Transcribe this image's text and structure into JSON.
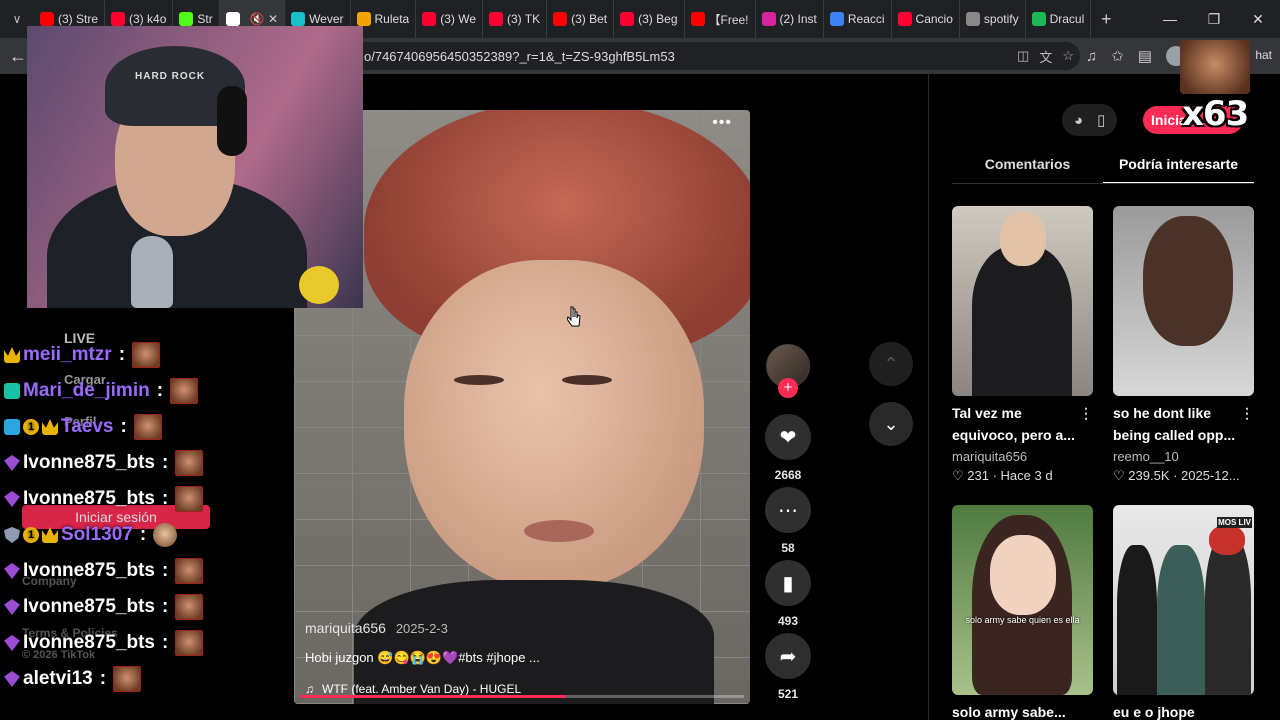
{
  "browser": {
    "tabs": [
      {
        "label": "(3) Stre",
        "color": "#ff0000"
      },
      {
        "label": "(3) k4o",
        "color": "#ff0033"
      },
      {
        "label": "Str",
        "color": "#53fc18"
      },
      {
        "label": "",
        "color": "#ffffff"
      },
      {
        "label": "Wever",
        "color": "#18c0c8"
      },
      {
        "label": "Ruleta",
        "color": "#f2a500"
      },
      {
        "label": "(3) We",
        "color": "#ff0033"
      },
      {
        "label": "(3) TK",
        "color": "#ff0033"
      },
      {
        "label": "(3) Bet",
        "color": "#ff0000"
      },
      {
        "label": "(3) Beg",
        "color": "#ff0033"
      },
      {
        "label": "【Free!",
        "color": "#ff0000"
      },
      {
        "label": "(2) Inst",
        "color": "#d6249f"
      },
      {
        "label": "Reacci",
        "color": "#3b82f6"
      },
      {
        "label": "Cancio",
        "color": "#ff0033"
      },
      {
        "label": "spotify",
        "color": "#888888"
      },
      {
        "label": "Dracul",
        "color": "#1db954"
      }
    ],
    "url": "o/7467406956450352389?_r=1&_t=ZS-93ghfB5Lm53",
    "chat_label": "hat"
  },
  "video": {
    "author": "mariquita656",
    "date": "2025-2-3",
    "caption": "Hobi juzgon 😅😋😭😍💜#bts #jhope ...",
    "music": "WTF (feat. Amber Van Day) - HUGEL",
    "progress": 0.6,
    "more_label": "•••"
  },
  "actions": {
    "likes": "2668",
    "comments": "58",
    "saves": "493",
    "shares": "521"
  },
  "right_panel": {
    "login": "Inicia",
    "tabs": [
      "Comentarios",
      "Podría interesarte"
    ],
    "cards": [
      {
        "title": "Tal vez me equivoco, pero a...",
        "author": "mariquita656",
        "likes": "231",
        "age": "Hace 3 d"
      },
      {
        "title": "so he dont like being called opp...",
        "author": "reemo__10",
        "likes": "239.5K",
        "age": "2025-12..."
      },
      {
        "title": "solo army sabe...",
        "author": "",
        "likes": "",
        "age": "",
        "overlay": "solo army sabe quien es ella"
      },
      {
        "title": "eu e o jhope tendo...",
        "author": "",
        "likes": "",
        "age": "",
        "overlay": "MOS LIV"
      }
    ]
  },
  "streamer": {
    "cap_text": "Hard Rock MONTRÉAL",
    "x_count": "x63"
  },
  "sidebar_remnants": {
    "live": "LIVE",
    "upload": "Cargar",
    "profile": "Perfil",
    "login": "Iniciar sesión",
    "company": "Company",
    "terms": "Terms & Policies",
    "copyright": "© 2026 TikTok"
  },
  "chat": [
    {
      "user": "meii_mtzr",
      "color": "#9b6bff",
      "badges": [
        "crown"
      ]
    },
    {
      "user": "Mari_de_jimin",
      "color": "#9b6bff",
      "badges": [
        "vip"
      ]
    },
    {
      "user": "Taevs",
      "color": "#9b6bff",
      "badges": [
        "cube",
        "one",
        "crown"
      ]
    },
    {
      "user": "Ivonne875_bts",
      "color": "#ffffff",
      "badges": [
        "gem"
      ]
    },
    {
      "user": "Ivonne875_bts",
      "color": "#ffffff",
      "badges": [
        "gem"
      ]
    },
    {
      "user": "Sol1307",
      "color": "#9b6bff",
      "badges": [
        "shield",
        "one",
        "crown"
      ]
    },
    {
      "user": "Ivonne875_bts",
      "color": "#ffffff",
      "badges": [
        "gem"
      ]
    },
    {
      "user": "Ivonne875_bts",
      "color": "#ffffff",
      "badges": [
        "gem"
      ]
    },
    {
      "user": "Ivonne875_bts",
      "color": "#ffffff",
      "badges": [
        "gem"
      ]
    },
    {
      "user": "aletvi13",
      "color": "#ffffff",
      "badges": [
        "gem"
      ]
    }
  ],
  "colors": {
    "accent": "#fe2c55"
  }
}
